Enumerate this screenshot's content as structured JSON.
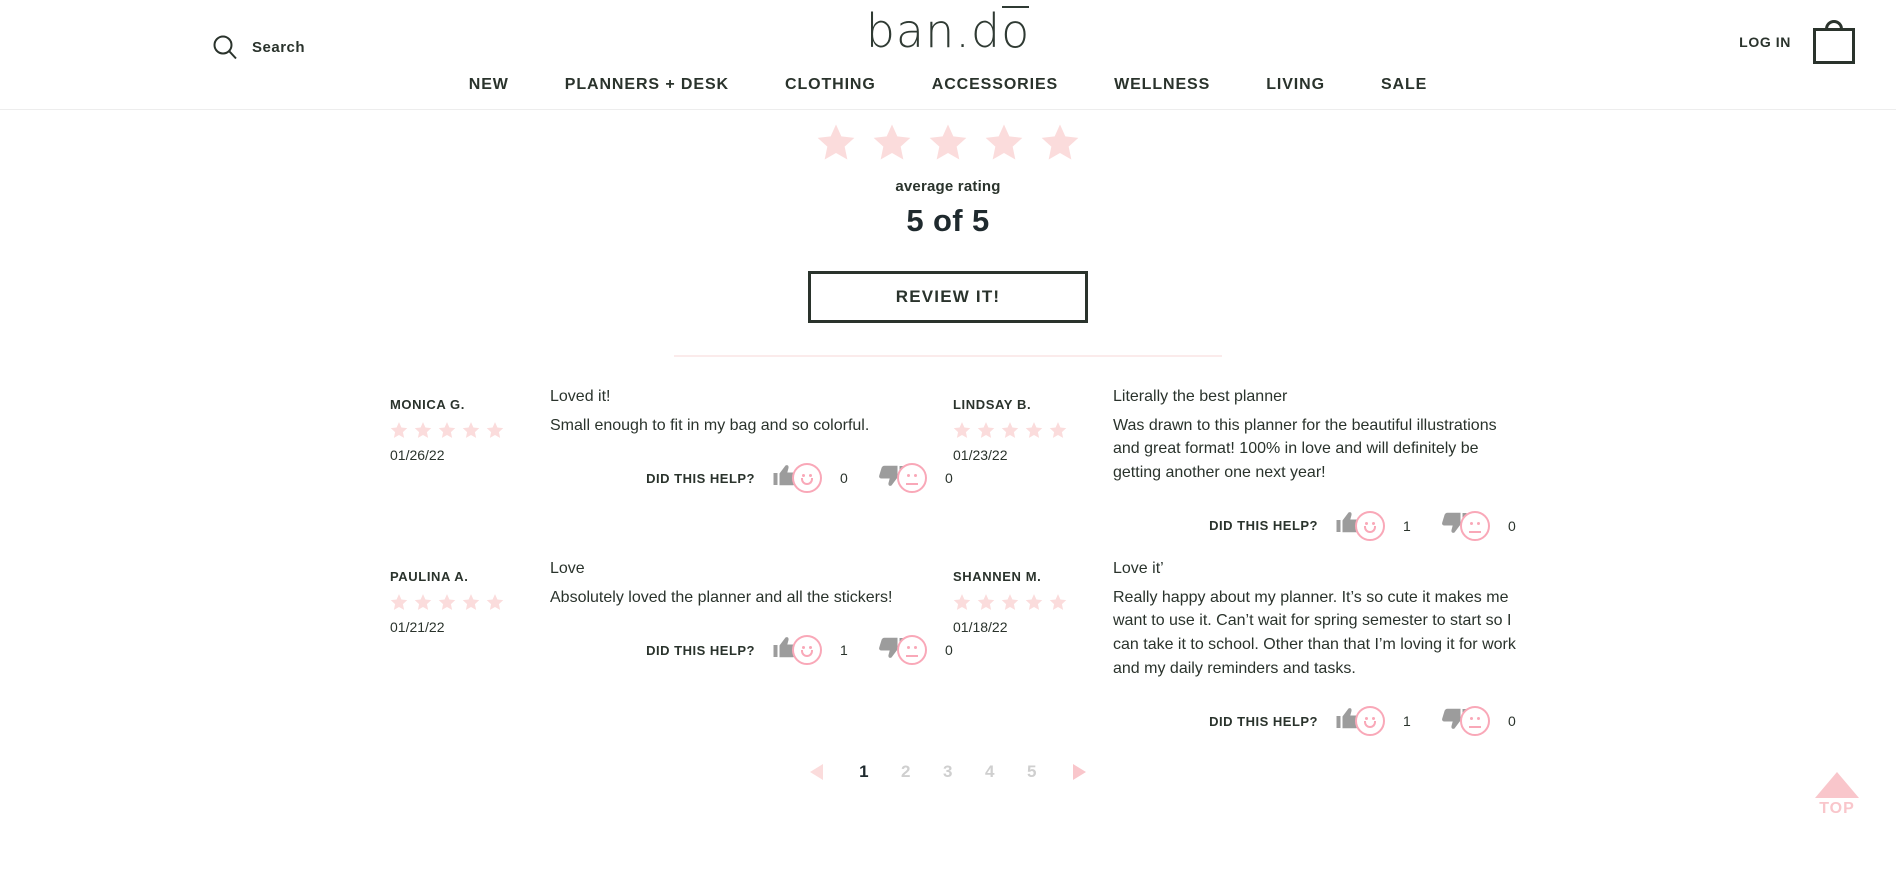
{
  "header": {
    "search": {
      "label": "Search",
      "icon": "search-icon"
    },
    "logo": {
      "before": "ban.d",
      "overlined": "o"
    },
    "login_label": "LOG IN",
    "cart_icon": "shopping-bag-icon",
    "nav": [
      {
        "label": "NEW"
      },
      {
        "label": "PLANNERS + DESK"
      },
      {
        "label": "CLOTHING"
      },
      {
        "label": "ACCESSORIES"
      },
      {
        "label": "WELLNESS"
      },
      {
        "label": "LIVING"
      },
      {
        "label": "SALE"
      }
    ]
  },
  "summary": {
    "stars_filled": 5,
    "average_label": "average rating",
    "average_value": "5 of 5",
    "review_button_label": "REVIEW IT!"
  },
  "reviews": [
    {
      "author": "MONICA G.",
      "stars": 5,
      "date": "01/26/22",
      "title": "Loved it!",
      "text": "Small enough to fit in my bag and so colorful.",
      "helpful_label": "DID THIS HELP?",
      "up_count": "0",
      "down_count": "0"
    },
    {
      "author": "LINDSAY B.",
      "stars": 5,
      "date": "01/23/22",
      "title": "Literally the best planner",
      "text": "Was drawn to this planner for the beautiful illustrations and great format! 100% in love and will definitely be getting another one next year!",
      "helpful_label": "DID THIS HELP?",
      "up_count": "1",
      "down_count": "0"
    },
    {
      "author": "PAULINA A.",
      "stars": 5,
      "date": "01/21/22",
      "title": "Love",
      "text": "Absolutely loved the planner and all the stickers!",
      "helpful_label": "DID THIS HELP?",
      "up_count": "1",
      "down_count": "0"
    },
    {
      "author": "SHANNEN M.",
      "stars": 5,
      "date": "01/18/22",
      "title": "Love it’",
      "text": "Really happy about my planner. It’s so cute it makes me want to use it. Can’t wait for spring semester to start so I can take it to school. Other than that I’m loving it for work and my daily reminders and tasks.",
      "helpful_label": "DID THIS HELP?",
      "up_count": "1",
      "down_count": "0"
    }
  ],
  "pagination": {
    "prev_icon": "chevron-left-icon",
    "next_icon": "chevron-right-icon",
    "pages": [
      {
        "label": "1",
        "active": true
      },
      {
        "label": "2",
        "active": false
      },
      {
        "label": "3",
        "active": false
      },
      {
        "label": "4",
        "active": false
      },
      {
        "label": "5",
        "active": false
      }
    ]
  },
  "back_to_top": {
    "label": "TOP",
    "icon": "triangle-up-icon"
  },
  "colors": {
    "ink": "#2a332c",
    "star_pink": "#fbdcdc",
    "accent_pink": "#f9a8b8",
    "soft_pink": "#f9c6cb",
    "thumb_gray": "#9c9c9c",
    "divider": "#fbebeb"
  }
}
